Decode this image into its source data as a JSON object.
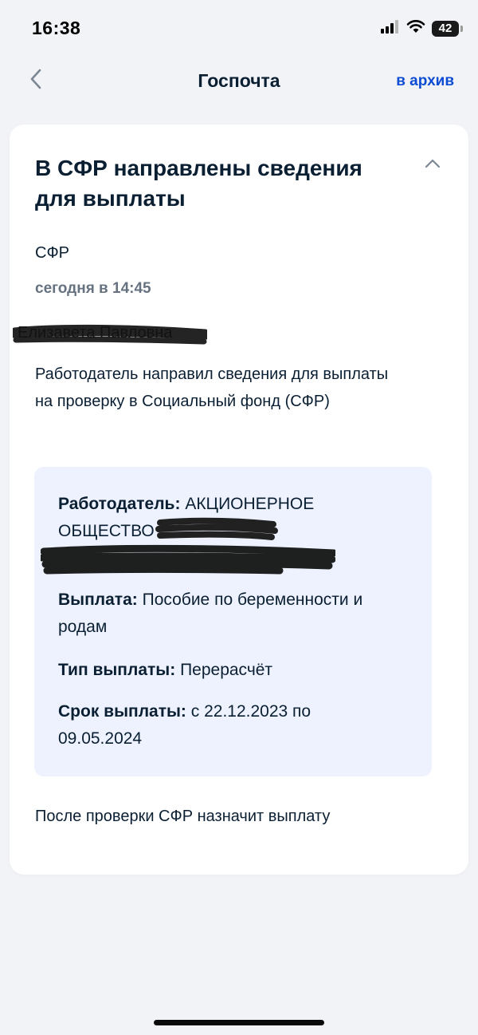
{
  "status_bar": {
    "time": "16:38",
    "battery": "42",
    "icons": [
      "signal-icon",
      "wifi-icon",
      "battery-icon"
    ]
  },
  "nav": {
    "back_icon": "chevron-left-icon",
    "title": "Госпочта",
    "action_label": "в архив",
    "accent_color": "#0d4cd3"
  },
  "message": {
    "title": "В СФР направлены сведения для выплаты",
    "collapse_icon": "chevron-up-icon",
    "sender": "СФР",
    "date": "сегодня в 14:45",
    "recipient": "Елизавета Павловна",
    "body": "Работодатель направил сведения для выплаты на проверку в Социальный фонд (СФР)",
    "details": {
      "employer_label": "Работодатель:",
      "employer_value": "АКЦИОНЕРНОЕ ОБЩЕСТВО",
      "payment_label": "Выплата:",
      "payment_value": "Пособие по беременности и родам",
      "type_label": "Тип выплаты:",
      "type_value": "Перерасчёт",
      "period_label": "Срок выплаты:",
      "period_value": "с 22.12.2023 по 09.05.2024"
    },
    "footer": "После проверки СФР назначит выплату"
  }
}
